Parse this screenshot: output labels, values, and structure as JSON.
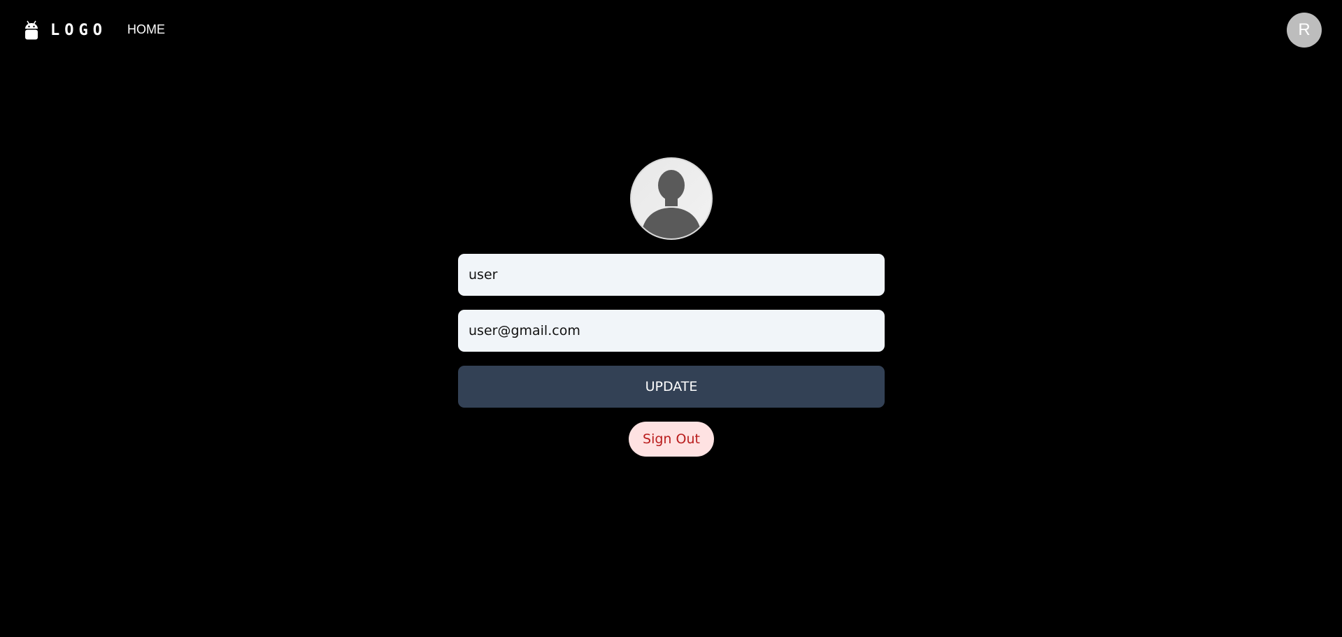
{
  "navbar": {
    "logo_text": "LOGO",
    "logo_icon": "android-icon",
    "home_label": "HOME",
    "user_initial": "R"
  },
  "profile": {
    "avatar_icon": "person-silhouette-icon",
    "username_value": "user",
    "email_value": "user@gmail.com",
    "update_label": "UPDATE",
    "signout_label": "Sign Out"
  },
  "colors": {
    "background": "#000000",
    "input_bg": "#f1f5f9",
    "update_bg": "#334155",
    "signout_bg": "#fee2e2",
    "signout_text": "#b91c1c",
    "avatar_bg": "#bdbdbd"
  }
}
